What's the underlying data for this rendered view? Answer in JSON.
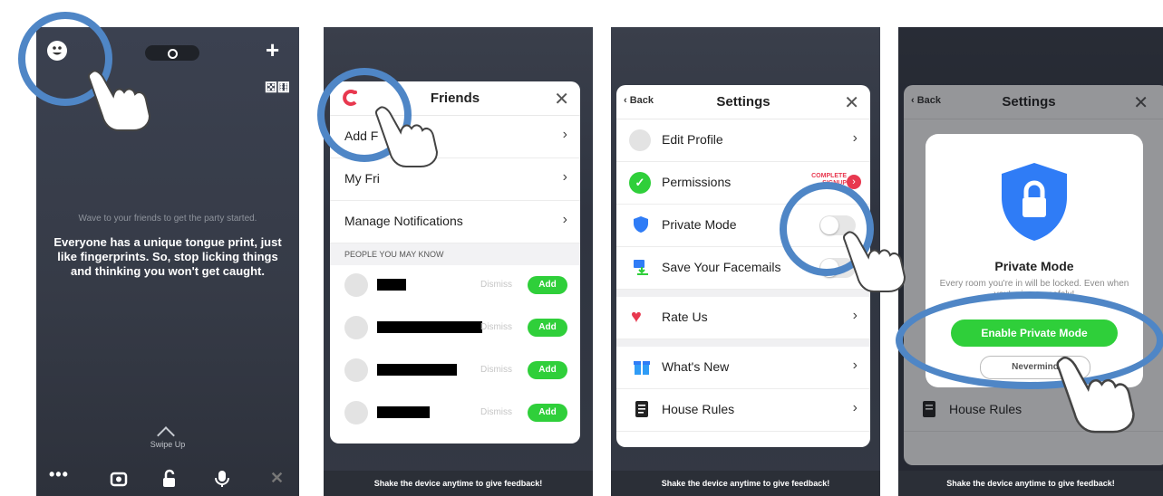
{
  "panel1": {
    "wave_text": "Wave to your friends to get the party started.",
    "fact_text": "Everyone has a unique tongue print, just like fingerprints. So, stop licking things and thinking you won't get caught.",
    "swipe_text": "Swipe Up"
  },
  "panel2": {
    "title": "Friends",
    "rows": [
      {
        "label": "Add F"
      },
      {
        "label": "My Fri"
      },
      {
        "label": "Manage Notifications"
      }
    ],
    "section_header": "PEOPLE YOU MAY KNOW",
    "dismiss_label": "Dismiss",
    "add_label": "Add",
    "feedback": "Shake the device anytime to give feedback!"
  },
  "panel3": {
    "back_label": "Back",
    "title": "Settings",
    "items": [
      {
        "label": "Edit Profile"
      },
      {
        "label": "Permissions",
        "badge": "COMPLETE SIGNUP"
      },
      {
        "label": "Private Mode"
      },
      {
        "label": "Save Your Facemails"
      },
      {
        "label": "Rate Us"
      },
      {
        "label": "What's New"
      },
      {
        "label": "House Rules"
      }
    ],
    "feedback": "Shake the device anytime to give feedback!"
  },
  "panel4": {
    "back_label": "Back",
    "title": "Settings",
    "house_rules": "House Rules",
    "modal_title": "Private Mode",
    "modal_text": "Every room you're in will be locked. Even when you're in one safely!",
    "enable_label": "Enable Private Mode",
    "nevermind_label": "Nevermind",
    "feedback": "Shake the device anytime to give feedback!"
  },
  "colors": {
    "accent_green": "#2fcf3a",
    "ring_blue": "#4f86c6",
    "heart_red": "#e8384f",
    "shield_blue": "#2f7cf6"
  }
}
